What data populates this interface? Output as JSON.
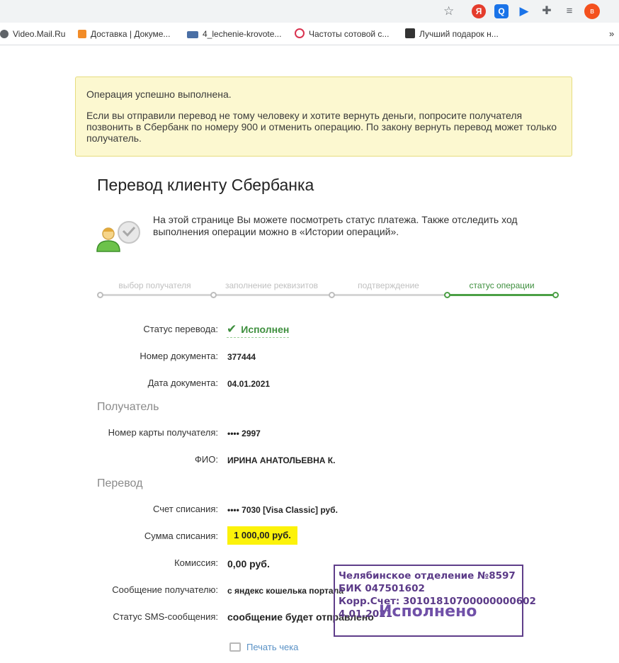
{
  "browser": {
    "extensions": [
      "Я",
      "Q",
      "▶",
      "✚",
      "≡"
    ],
    "avatar_letter": "в",
    "bookmarks": [
      {
        "label": "Video.Mail.Ru",
        "icon": "globe-icon",
        "color": "#5f6368"
      },
      {
        "label": "Доставка | Докуме...",
        "icon": "cart-icon",
        "color": "#f28c28"
      },
      {
        "label": "4_lechenie-krovote...",
        "icon": "nkf-icon",
        "color": "#4a6fa5"
      },
      {
        "label": "Частоты сотовой с...",
        "icon": "signal-icon",
        "color": "#d9324f"
      },
      {
        "label": "Лучший подарок н...",
        "icon": "sparkle-icon",
        "color": "#333333"
      }
    ],
    "more_label": "»"
  },
  "alert": {
    "line1": "Операция успешно выполнена.",
    "line2": "Если вы отправили перевод не тому человеку и хотите вернуть деньги, попросите получателя позвонить в Сбербанк по номеру 900 и отменить операцию. По закону вернуть перевод может только получатель."
  },
  "page": {
    "title": "Перевод клиенту Сбербанка",
    "intro": "На этой странице Вы можете посмотреть статус платежа. Также отследить ход выполнения операции можно в «Истории операций»."
  },
  "stepper": {
    "steps": [
      "выбор получателя",
      "заполнение реквизитов",
      "подтверждение",
      "статус операции"
    ],
    "active_index": 3
  },
  "fields": {
    "status_label": "Статус перевода:",
    "status_value": "Исполнен",
    "doc_number_label": "Номер документа:",
    "doc_number_value": "377444",
    "doc_date_label": "Дата документа:",
    "doc_date_value": "04.01.2021",
    "recipient_section": "Получатель",
    "card_label": "Номер карты получателя:",
    "card_value": "•••• 2997",
    "fio_label": "ФИО:",
    "fio_value": "ИРИНА АНАТОЛЬЕВНА К.",
    "transfer_section": "Перевод",
    "account_label": "Счет списания:",
    "account_value": "•••• 7030  [Visa Classic]  руб.",
    "amount_label": "Сумма списания:",
    "amount_value": "1 000,00  руб.",
    "fee_label": "Комиссия:",
    "fee_value": "0,00 руб.",
    "message_label": "Сообщение получателю:",
    "message_value": "с яндекс кошелька портала",
    "sms_label": "Статус SMS-сообщения:",
    "sms_value": "сообщение будет отправлено",
    "print_label": "Печать чека"
  },
  "stamp": {
    "line1": "Челябинское отделение №8597",
    "line2": "БИК 047501602",
    "line3": "Корр.Счет: 30101810700000000602",
    "line4": "4.01.2021",
    "big": "Исполнено"
  },
  "colors": {
    "success_green": "#3e8f3e",
    "alert_bg": "#fcf8d0",
    "highlight_yellow": "#fcf20a",
    "stamp_purple": "#5b3a88",
    "link_blue": "#5a92c6"
  }
}
